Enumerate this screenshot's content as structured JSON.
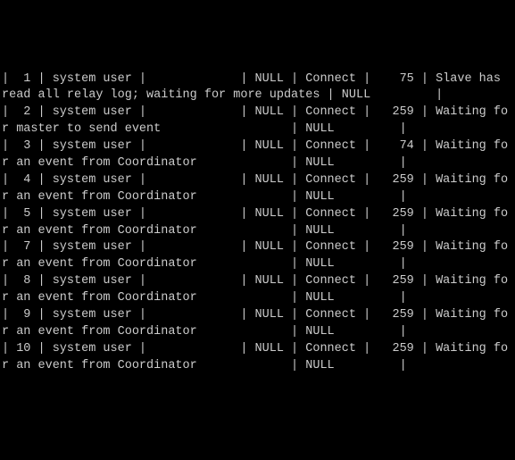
{
  "rows": [
    {
      "id": " 1",
      "user": "system user",
      "host": "           ",
      "db": "NULL",
      "command": "Connect",
      "time": "   75",
      "state": "Slave has read all relay log; waiting for more updates",
      "info": "NULL"
    },
    {
      "id": " 2",
      "user": "system user",
      "host": "           ",
      "db": "NULL",
      "command": "Connect",
      "time": "  259",
      "state": "Waiting for master to send event                 ",
      "info": "NULL"
    },
    {
      "id": " 3",
      "user": "system user",
      "host": "           ",
      "db": "NULL",
      "command": "Connect",
      "time": "   74",
      "state": "Waiting for an event from Coordinator            ",
      "info": "NULL"
    },
    {
      "id": " 4",
      "user": "system user",
      "host": "           ",
      "db": "NULL",
      "command": "Connect",
      "time": "  259",
      "state": "Waiting for an event from Coordinator            ",
      "info": "NULL"
    },
    {
      "id": " 5",
      "user": "system user",
      "host": "           ",
      "db": "NULL",
      "command": "Connect",
      "time": "  259",
      "state": "Waiting for an event from Coordinator            ",
      "info": "NULL"
    },
    {
      "id": " 7",
      "user": "system user",
      "host": "           ",
      "db": "NULL",
      "command": "Connect",
      "time": "  259",
      "state": "Waiting for an event from Coordinator            ",
      "info": "NULL"
    },
    {
      "id": " 8",
      "user": "system user",
      "host": "           ",
      "db": "NULL",
      "command": "Connect",
      "time": "  259",
      "state": "Waiting for an event from Coordinator            ",
      "info": "NULL"
    },
    {
      "id": " 9",
      "user": "system user",
      "host": "           ",
      "db": "NULL",
      "command": "Connect",
      "time": "  259",
      "state": "Waiting for an event from Coordinator            ",
      "info": "NULL"
    },
    {
      "id": "10",
      "user": "system user",
      "host": "           ",
      "db": "NULL",
      "command": "Connect",
      "time": "  259",
      "state": "Waiting for an event from Coordinator            ",
      "info": "NULL"
    }
  ]
}
